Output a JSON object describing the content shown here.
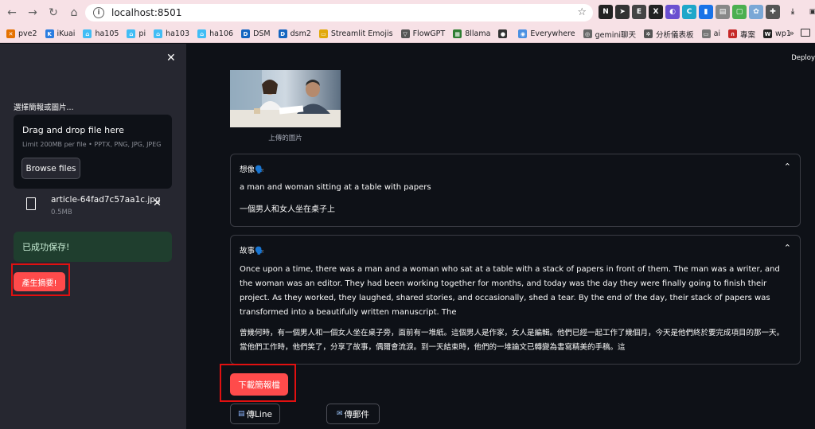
{
  "browser": {
    "url": "localhost:8501",
    "bookmarks": [
      {
        "label": "pve2",
        "color": "#e57200",
        "glyph": "✕"
      },
      {
        "label": "iKuai",
        "color": "#2a7de1",
        "glyph": "K"
      },
      {
        "label": "ha105",
        "color": "#41bdf5",
        "glyph": "⌂"
      },
      {
        "label": "pi",
        "color": "#41bdf5",
        "glyph": "⌂"
      },
      {
        "label": "ha103",
        "color": "#41bdf5",
        "glyph": "⌂"
      },
      {
        "label": "ha106",
        "color": "#41bdf5",
        "glyph": "⌂"
      },
      {
        "label": "DSM",
        "color": "#1565c0",
        "glyph": "D"
      },
      {
        "label": "dsm2",
        "color": "#1565c0",
        "glyph": "D"
      },
      {
        "label": "Streamlit Emojis",
        "color": "#e2a90a",
        "glyph": "▭"
      },
      {
        "label": "FlowGPT",
        "color": "#555555",
        "glyph": "▽"
      },
      {
        "label": "8llama",
        "color": "#2e7d32",
        "glyph": "▦"
      },
      {
        "label": "",
        "color": "#333333",
        "glyph": "●"
      },
      {
        "label": "Everywhere",
        "color": "#4a90e2",
        "glyph": "◉"
      },
      {
        "label": "gemini聊天",
        "color": "#666666",
        "glyph": "◎"
      },
      {
        "label": "分析儀表板",
        "color": "#555555",
        "glyph": "✲"
      },
      {
        "label": "ai",
        "color": "#777777",
        "glyph": "▭"
      },
      {
        "label": "專案",
        "color": "#c62828",
        "glyph": "∩"
      },
      {
        "label": "wp1",
        "color": "#222222",
        "glyph": "W"
      }
    ]
  },
  "sidebar": {
    "uploader_label": "選擇簡報或圖片...",
    "drop_title": "Drag and drop file here",
    "drop_limit": "Limit 200MB per file • PPTX, PNG, JPG, JPEG",
    "browse_label": "Browse files",
    "file_name": "article-64fad7c57aa1c.jpg",
    "file_size": "0.5MB",
    "success_message": "已成功保存!",
    "generate_label": "產生摘要!"
  },
  "main": {
    "deploy_label": "Deploy",
    "image_caption": "上傳的圖片",
    "imagine": {
      "title": "想像🗣️",
      "english": "a man and woman sitting at a table with papers",
      "chinese": "一個男人和女人坐在桌子上"
    },
    "story": {
      "title": "故事🗣️",
      "english": "Once upon a time, there was a man and a woman who sat at a table with a stack of papers in front of them. The man was a writer, and the woman was an editor. They had been working together for months, and today was the day they were finally going to finish their project. As they worked, they laughed, shared stories, and occasionally, shed a tear. By the end of the day, their stack of papers was transformed into a beautifully written manuscript. The",
      "chinese": "曾幾何時，有一個男人和一個女人坐在桌子旁，面前有一堆紙。這個男人是作家，女人是編輯。他們已經一起工作了幾個月，今天是他們終於要完成項目的那一天。當他們工作時，他們笑了，分享了故事，偶爾會流淚。到一天結束時，他們的一堆論文已轉變為書寫精美的手稿。這"
    },
    "download_label": "下載簡報檔",
    "line_label": "傳Line",
    "email_label": "傳郵件"
  }
}
